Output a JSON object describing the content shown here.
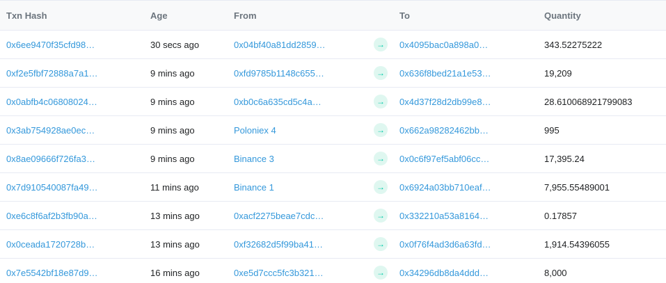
{
  "headers": {
    "txn_hash": "Txn Hash",
    "age": "Age",
    "from": "From",
    "to": "To",
    "quantity": "Quantity"
  },
  "arrow_glyph": "→",
  "colors": {
    "link": "#3498db",
    "arrow": "#00c9a7",
    "arrow_bg": "#dff7f0"
  },
  "rows": [
    {
      "hash": "0x6ee9470f35cfd98…",
      "age": "30 secs ago",
      "from": "0x04bf40a81dd2859…",
      "to": "0x4095bac0a898a0…",
      "quantity": "343.52275222"
    },
    {
      "hash": "0xf2e5fbf72888a7a1…",
      "age": "9 mins ago",
      "from": "0xfd9785b1148c655…",
      "to": "0x636f8bed21a1e53…",
      "quantity": "19,209"
    },
    {
      "hash": "0x0abfb4c06808024…",
      "age": "9 mins ago",
      "from": "0xb0c6a635cd5c4a…",
      "to": "0x4d37f28d2db99e8…",
      "quantity": "28.610068921799083"
    },
    {
      "hash": "0x3ab754928ae0ec…",
      "age": "9 mins ago",
      "from": "Poloniex 4",
      "to": "0x662a98282462bb…",
      "quantity": "995"
    },
    {
      "hash": "0x8ae09666f726fa3…",
      "age": "9 mins ago",
      "from": "Binance 3",
      "to": "0x0c6f97ef5abf06cc…",
      "quantity": "17,395.24"
    },
    {
      "hash": "0x7d910540087fa49…",
      "age": "11 mins ago",
      "from": "Binance 1",
      "to": "0x6924a03bb710eaf…",
      "quantity": "7,955.55489001"
    },
    {
      "hash": "0xe6c8f6af2b3fb90a…",
      "age": "13 mins ago",
      "from": "0xacf2275beae7cdc…",
      "to": "0x332210a53a8164…",
      "quantity": "0.17857"
    },
    {
      "hash": "0x0ceada1720728b…",
      "age": "13 mins ago",
      "from": "0xf32682d5f99ba41…",
      "to": "0x0f76f4ad3d6a63fd…",
      "quantity": "1,914.54396055"
    },
    {
      "hash": "0x7e5542bf18e87d9…",
      "age": "16 mins ago",
      "from": "0xe5d7ccc5fc3b321…",
      "to": "0x34296db8da4ddd…",
      "quantity": "8,000"
    }
  ]
}
